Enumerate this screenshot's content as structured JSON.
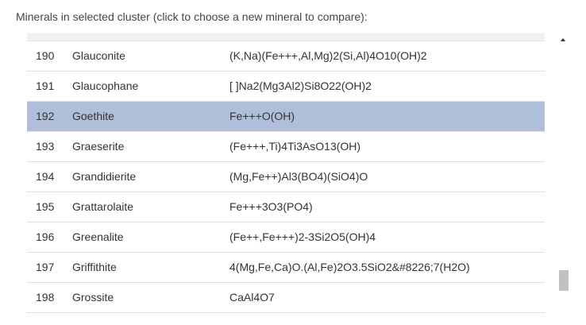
{
  "caption": "Minerals in selected cluster (click to choose a new mineral to compare):",
  "minerals": [
    {
      "num": "190",
      "name": "Glauconite",
      "formula": "(K,Na)(Fe+++,Al,Mg)2(Si,Al)4O10(OH)2"
    },
    {
      "num": "191",
      "name": "Glaucophane",
      "formula": "[ ]Na2(Mg3Al2)Si8O22(OH)2"
    },
    {
      "num": "192",
      "name": "Goethite",
      "formula": "Fe+++O(OH)",
      "selected": true
    },
    {
      "num": "193",
      "name": "Graeserite",
      "formula": "(Fe+++,Ti)4Ti3AsO13(OH)"
    },
    {
      "num": "194",
      "name": "Grandidierite",
      "formula": "(Mg,Fe++)Al3(BO4)(SiO4)O"
    },
    {
      "num": "195",
      "name": "Grattarolaite",
      "formula": "Fe+++3O3(PO4)"
    },
    {
      "num": "196",
      "name": "Greenalite",
      "formula": "(Fe++,Fe+++)2-3Si2O5(OH)4"
    },
    {
      "num": "197",
      "name": "Griffithite",
      "formula": "4(Mg,Fe,Ca)O.(Al,Fe)2O3.5SiO2&#8226;7(H2O)"
    },
    {
      "num": "198",
      "name": "Grossite",
      "formula": "CaAl4O7"
    }
  ],
  "colors": {
    "selected_row": "#b0bfd9",
    "row_border": "#e0e0e0",
    "scroll_thumb": "#c1c1c1"
  },
  "icons": {
    "scroll_up": "triangle-up-icon"
  }
}
